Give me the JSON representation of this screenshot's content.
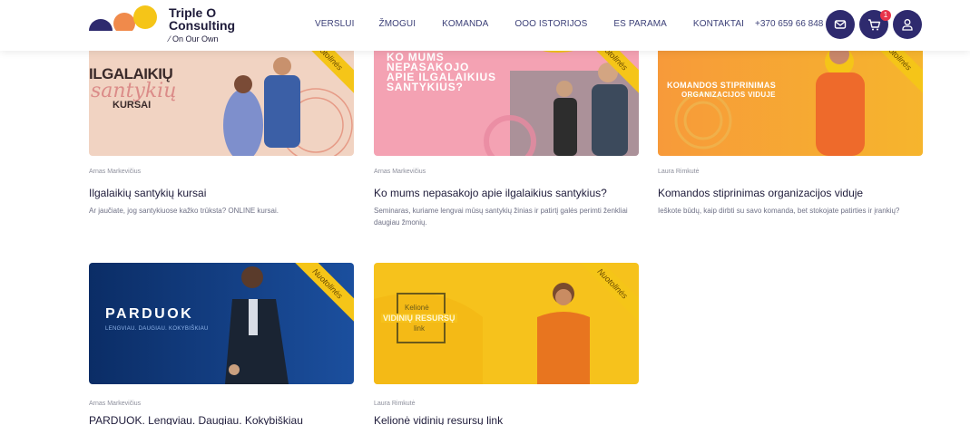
{
  "header": {
    "logo": {
      "line1": "Triple O",
      "line2": "Consulting",
      "tagline": "⁄ On Our Own"
    },
    "nav": [
      "VERSLUI",
      "ŽMOGUI",
      "KOMANDA",
      "OOO ISTORIJOS",
      "ES PARAMA",
      "KONTAKTAI"
    ],
    "phone": "+370 659 66 848",
    "cart_count": "1"
  },
  "colors": {
    "brand": "#2e2a6e",
    "ribbon": "#f5c518",
    "badge": "#e8334a"
  },
  "cards": [
    {
      "image_text": [
        "ILGALAIKIŲ",
        "santykių",
        "KURSAI"
      ],
      "ribbon": "Nuotolinės",
      "author": "Arnas Markevičius",
      "title": "Ilgalaikių santykių kursai",
      "desc": "Ar jaučiate, jog santykiuose kažko trūksta? ONLINE kursai."
    },
    {
      "image_text": [
        "KO MUMS",
        "NEPASAKOJO",
        "APIE ILGALAIKIUS",
        "SANTYKIUS?"
      ],
      "ribbon": "Nuotolinės",
      "author": "Arnas Markevičius",
      "title": "Ko mums nepasakojo apie ilgalaikius santykius?",
      "desc": "Seminaras, kuriame lengvai mūsų santykių žinias ir patirtį galės perimti ženkliai daugiau žmonių."
    },
    {
      "image_text": [
        "KOMANDOS STIPRINIMAS",
        "ORGANIZACIJOS VIDUJE"
      ],
      "ribbon": "Nuotolinės",
      "author": "Laura Rimkutė",
      "title": "Komandos stiprinimas organizacijos viduje",
      "desc": "Ieškote būdų, kaip dirbti su savo komanda, bet stokojate patirties ir įrankių?"
    },
    {
      "image_text": [
        "PARDUOK",
        "LENGVIAU. DAUGIAU. KOKYBIŠKIAU"
      ],
      "ribbon": "Nuotolinės",
      "author": "Arnas Markevičius",
      "title": "PARDUOK. Lengviau. Daugiau. Kokybiškiau",
      "desc": ""
    },
    {
      "image_text": [
        "Kelionė",
        "VIDINIŲ RESURSŲ",
        "link"
      ],
      "ribbon": "Nuotolinės",
      "author": "Laura Rimkutė",
      "title": "Kelionė vidinių resursų link",
      "desc": ""
    }
  ]
}
